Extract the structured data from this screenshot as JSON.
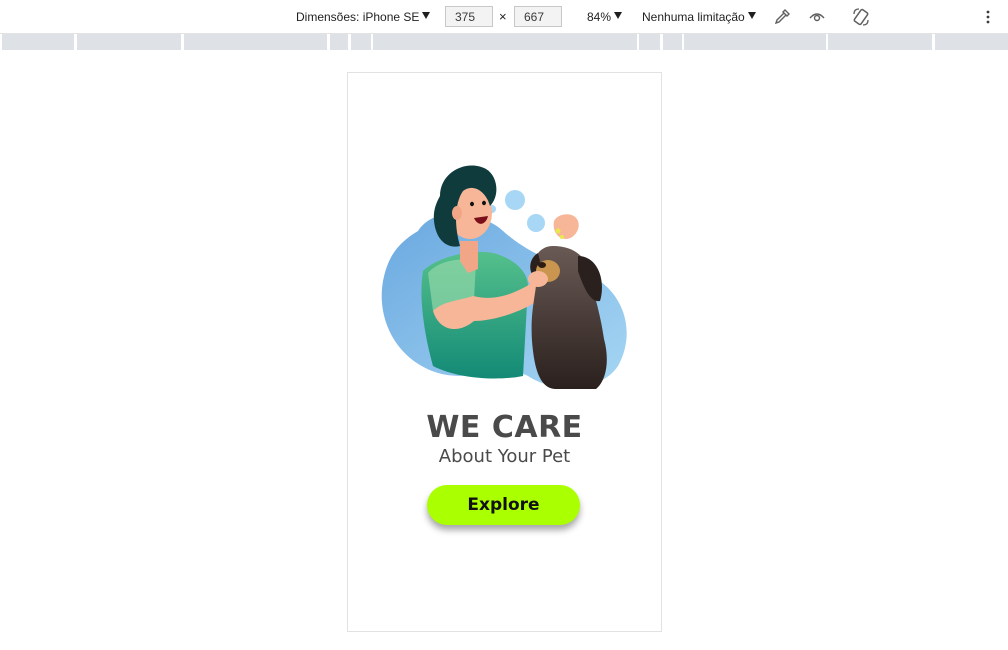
{
  "toolbar": {
    "dimensions_label": "Dimensões: iPhone SE",
    "width_value": "375",
    "times_symbol": "×",
    "height_value": "667",
    "zoom_label": "84%",
    "throttle_label": "Nenhuma limitação",
    "icons": [
      "eyedropper-icon",
      "eye-icon",
      "rotate-icon",
      "more-vert-icon"
    ]
  },
  "app": {
    "headline": "WE CARE",
    "subheadline": "About Your Pet",
    "cta_label": "Explore"
  },
  "colors": {
    "accent": "#aaff00",
    "text": "#4a4a4a",
    "blob": "#7fb7e6"
  }
}
